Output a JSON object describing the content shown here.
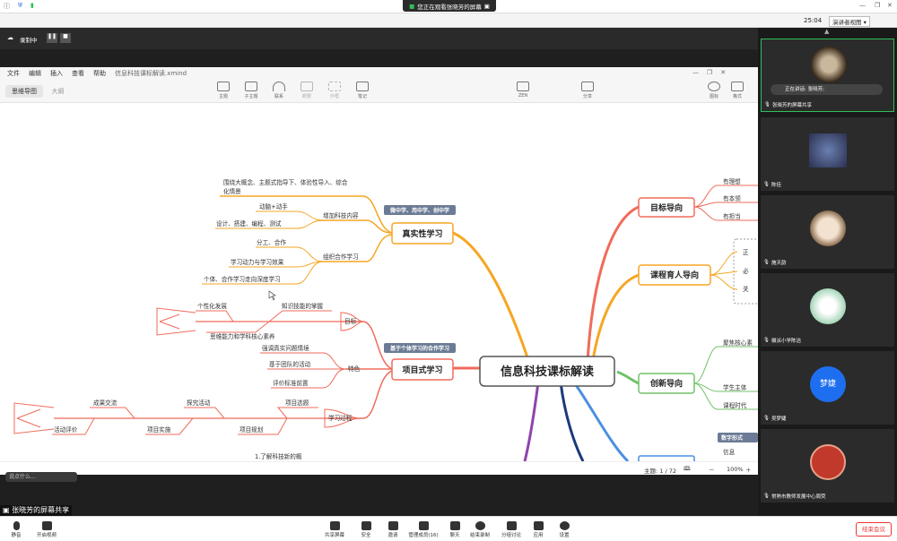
{
  "meeting": {
    "share_banner": "您正在观看张晓芳的屏幕",
    "recording_label": "录制中",
    "time": "25:04",
    "view_mode": "演讲者视图",
    "sharer_label": "张晓芳的屏幕共享",
    "chat_placeholder": "说点什么..."
  },
  "xmind": {
    "menu": [
      "文件",
      "编辑",
      "插入",
      "查看",
      "帮助"
    ],
    "file_name": "信息科技课标解读.xmind",
    "tabs": [
      "思维导图",
      "大纲"
    ],
    "toolbar": {
      "topic": "主题",
      "subtopic": "子主题",
      "relation": "联系",
      "summary": "概要",
      "boundary": "外框",
      "note": "笔记",
      "zen": "ZEN",
      "share": "分享",
      "icon": "图标",
      "format": "格式"
    },
    "status": {
      "topic_count": "主题: 1 / 72",
      "zoom": "100%"
    }
  },
  "mindmap": {
    "central": "信息科技课标解读",
    "cat1": {
      "title": "真实性学习",
      "badge": "微中学、用中学、创中学",
      "b1": "围绕大概念、主题式指导下、体验性导入、综合",
      "b1b": "化情景",
      "g1": "增加科技内容",
      "g1a": "动脑+动手",
      "g1b": "设计、搭建、编程、测试",
      "g2": "组织合作学习",
      "g2a": "分工、合作",
      "g2b": "学习动力与学习效果",
      "g2c": "个体、合作学习走向深度学习"
    },
    "cat2": {
      "title": "项目式学习",
      "badge": "基于个体学习的合作学习",
      "goal": "目标",
      "goal_a": "个性化发展",
      "goal_b": "知识技能的掌握",
      "goal_c": "思维能力和学科核心素养",
      "feat": "特色",
      "feat_a": "强调真实问题情境",
      "feat_b": "基于团队的活动",
      "feat_c": "评价标准前置",
      "proc": "学习过程",
      "proc_a": "项目选题",
      "proc_b": "项目规划",
      "proc_c": "探究活动",
      "proc_d": "项目实施",
      "proc_e": "成果交流",
      "proc_f": "活动评价"
    },
    "right": {
      "r1": "目标导向",
      "r1a": "有理想",
      "r1b": "有本领",
      "r1c": "有担当",
      "r2": "课程育人导向",
      "r2a": "正",
      "r2b": "必",
      "r2c": "关",
      "r3": "创新导向",
      "r3a": "聚焦核心素",
      "r3b": "学生主体",
      "r3c": "课程时代",
      "r4": "数字形式",
      "r4a": "信息"
    },
    "bottom_partial": "1.了解科技新的概"
  },
  "participants": [
    {
      "name": "张晓芳的屏幕共享",
      "status": "正在讲话: 张晓芳;"
    },
    {
      "name": "陈佳"
    },
    {
      "name": "施天韵"
    },
    {
      "name": "徽派小学陈洁"
    },
    {
      "name": "吴梦婕",
      "avatar_text": "梦婕"
    },
    {
      "name": "常熟市教师发展中心周荧"
    }
  ],
  "bottom": {
    "mute": "静音",
    "video": "开启视频",
    "share": "共享屏幕",
    "security": "安全",
    "invite": "邀请",
    "members": "管理成员(16)",
    "chat": "聊天",
    "record": "结束录制",
    "breakout": "分组讨论",
    "apps": "应用",
    "settings": "设置",
    "end": "结束会议"
  },
  "colors": {
    "orange": "#f6a623",
    "red": "#f06b5a",
    "green": "#72c16a",
    "blue": "#4a90e2",
    "purple": "#8e44ad",
    "badge": "#6b7b95",
    "active_speaker": "#2fbf5a"
  }
}
